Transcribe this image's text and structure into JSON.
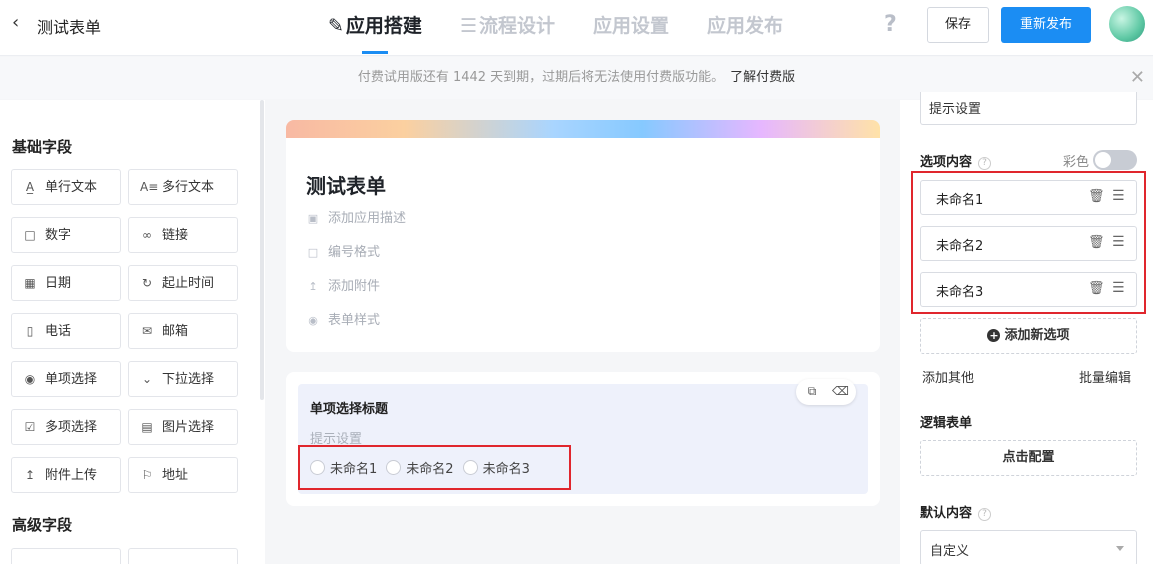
{
  "header": {
    "back_icon": "chevron-left-icon",
    "title": "测试表单",
    "tabs": [
      {
        "label": "应用搭建",
        "icon": "edit-icon",
        "active": true
      },
      {
        "label": "流程设计",
        "icon": "flow-icon",
        "active": false
      },
      {
        "label": "应用设置",
        "active": false
      },
      {
        "label": "应用发布",
        "active": false
      }
    ],
    "help_icon": "question-icon",
    "save_label": "保存",
    "publish_label": "重新发布",
    "accent_color": "#1b8df3"
  },
  "notice": {
    "text": "付费试用版还有 1442 天到期，过期后将无法使用付费版功能。",
    "link": "了解付费版"
  },
  "left": {
    "basic_title": "基础字段",
    "basic_fields": [
      {
        "label": "单行文本",
        "icon": "single-text-icon"
      },
      {
        "label": "多行文本",
        "icon": "multi-text-icon"
      },
      {
        "label": "数字",
        "icon": "number-icon"
      },
      {
        "label": "链接",
        "icon": "link-icon"
      },
      {
        "label": "日期",
        "icon": "calendar-icon"
      },
      {
        "label": "起止时间",
        "icon": "time-range-icon"
      },
      {
        "label": "电话",
        "icon": "phone-icon"
      },
      {
        "label": "邮箱",
        "icon": "mail-icon"
      },
      {
        "label": "单项选择",
        "icon": "radio-icon"
      },
      {
        "label": "下拉选择",
        "icon": "dropdown-icon"
      },
      {
        "label": "多项选择",
        "icon": "checkbox-icon"
      },
      {
        "label": "图片选择",
        "icon": "image-icon"
      },
      {
        "label": "附件上传",
        "icon": "upload-icon"
      },
      {
        "label": "地址",
        "icon": "location-icon"
      }
    ],
    "advanced_title": "高级字段"
  },
  "canvas": {
    "form_title": "测试表单",
    "meta": [
      {
        "label": "添加应用描述",
        "icon": "comment-icon"
      },
      {
        "label": "编号格式",
        "icon": "number-format-icon"
      },
      {
        "label": "添加附件",
        "icon": "attach-icon"
      },
      {
        "label": "表单样式",
        "icon": "palette-icon"
      }
    ],
    "question": {
      "title": "单项选择标题",
      "hint": "提示设置",
      "options": [
        "未命名1",
        "未命名2",
        "未命名3"
      ]
    }
  },
  "right": {
    "hint_value": "提示设置",
    "options_label": "选项内容",
    "color_label": "彩色",
    "color_enabled": false,
    "options": [
      "未命名1",
      "未命名2",
      "未命名3"
    ],
    "add_option": "添加新选项",
    "add_other": "添加其他",
    "batch_edit": "批量编辑",
    "logic_label": "逻辑表单",
    "configure": "点击配置",
    "default_label": "默认内容",
    "default_value": "自定义"
  }
}
